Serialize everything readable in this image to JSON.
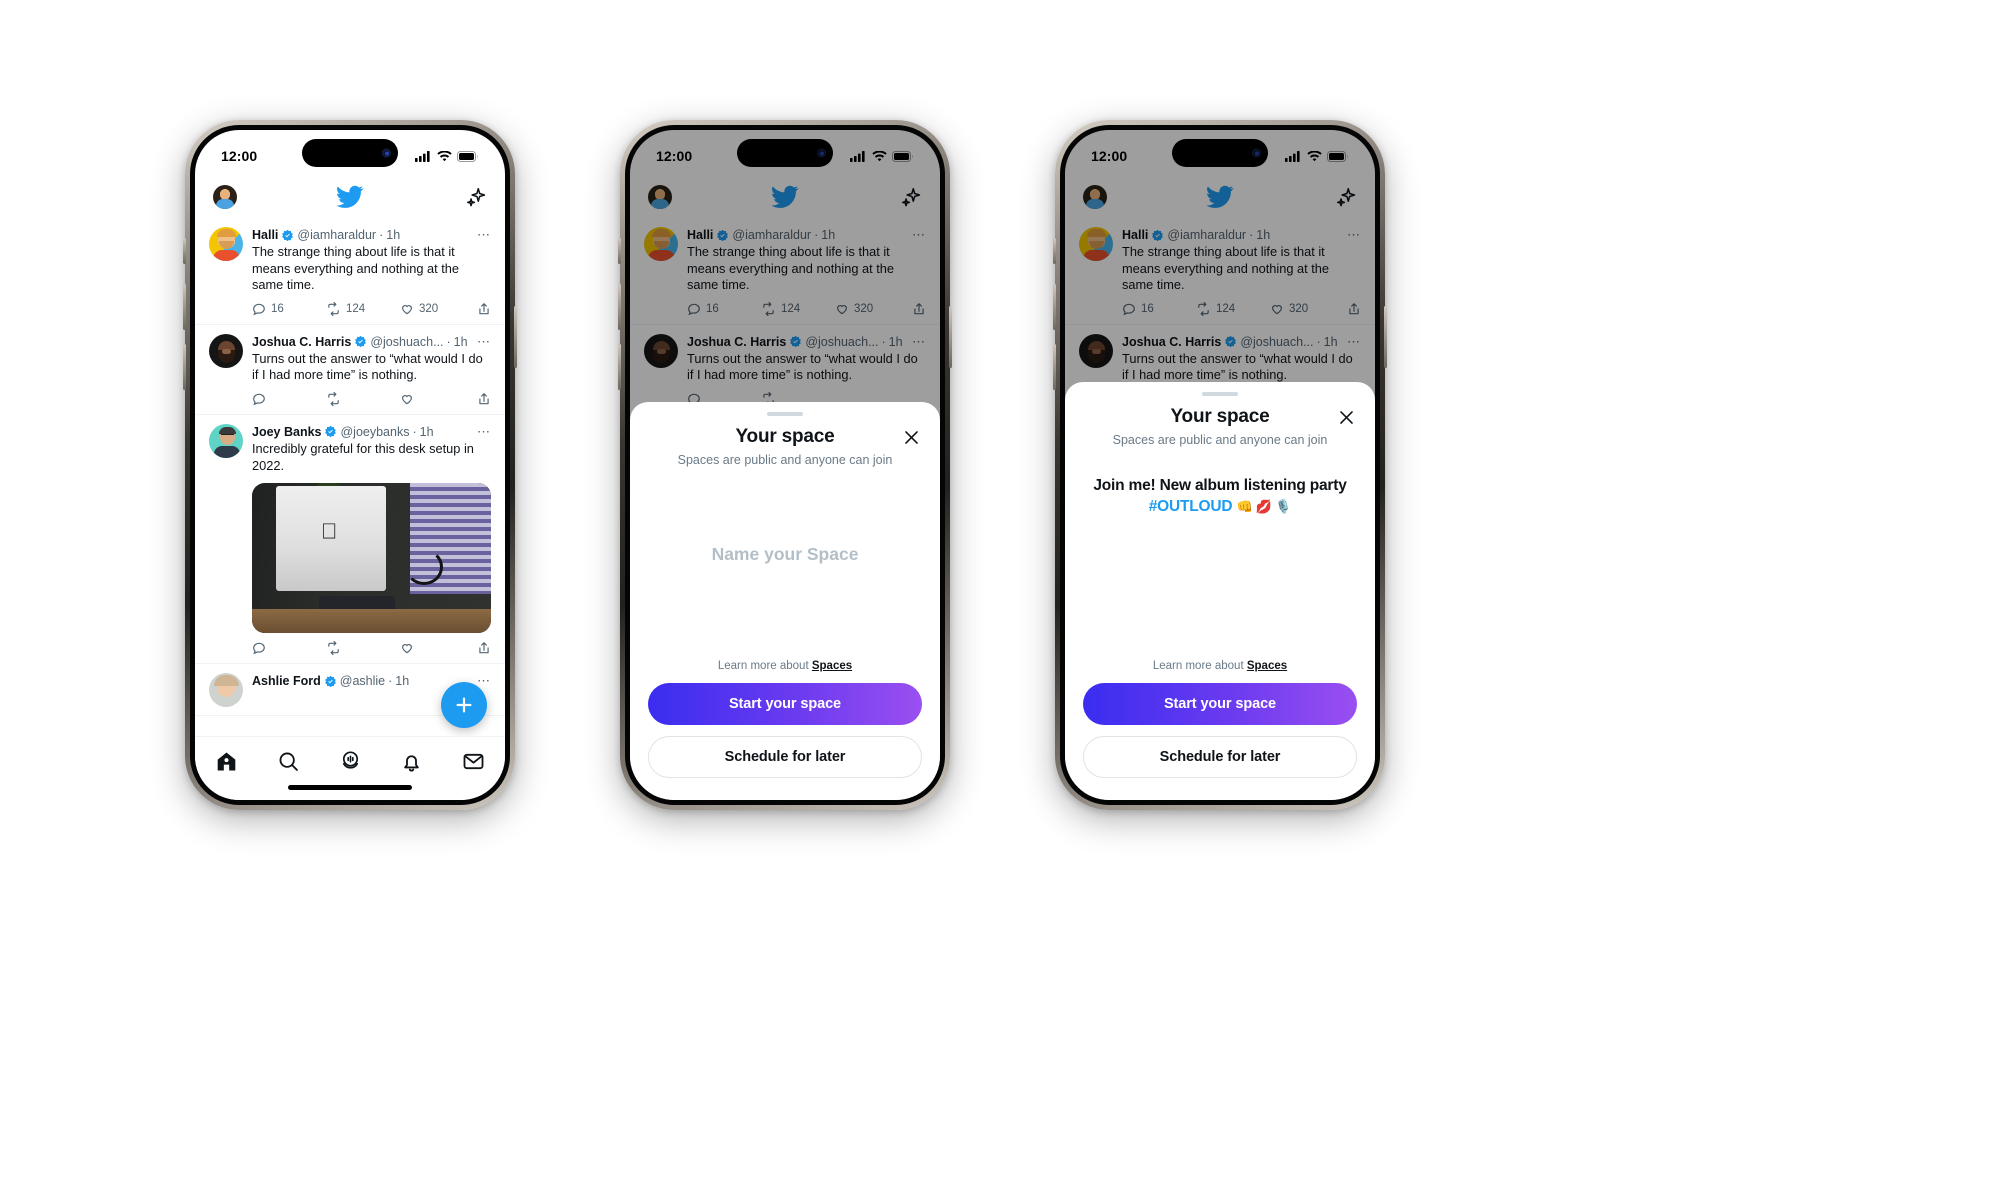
{
  "status_bar": {
    "time": "12:00",
    "icons": [
      "cellular-signal-icon",
      "wifi-icon",
      "battery-icon"
    ]
  },
  "app_header": {
    "avatar_name": "user-avatar",
    "logo": "twitter-bird-logo",
    "sparkle": "sparkle-icon"
  },
  "feed": {
    "tweets": [
      {
        "name": "Halli",
        "verified": true,
        "handle": "@iamharaldur",
        "time": "1h",
        "separator": "·",
        "text": "The strange thing about life is that it means everything and nothing at the same time.",
        "replies": "16",
        "retweets": "124",
        "likes": "320",
        "has_counts": true,
        "has_media": false
      },
      {
        "name": "Joshua C. Harris",
        "verified": true,
        "handle": "@joshuach...",
        "time": "1h",
        "separator": "·",
        "text": "Turns out the answer to “what would I do if I had more time” is nothing.",
        "replies": "",
        "retweets": "",
        "likes": "",
        "has_counts": false,
        "has_media": false
      },
      {
        "name": "Joey Banks",
        "verified": true,
        "handle": "@joeybanks",
        "time": "1h",
        "separator": "·",
        "text": "Incredibly grateful for this desk setup in 2022.",
        "replies": "",
        "retweets": "",
        "likes": "",
        "has_counts": false,
        "has_media": true,
        "media_alt": "desk-setup-photo"
      },
      {
        "name": "Ashlie Ford",
        "verified": true,
        "handle": "@ashlie",
        "time": "1h",
        "separator": "·",
        "text": "",
        "replies": "",
        "retweets": "",
        "likes": "",
        "has_counts": false,
        "has_media": false
      }
    ],
    "action_icons": [
      "reply-icon",
      "retweet-icon",
      "like-icon",
      "share-icon"
    ],
    "compose_fab": "compose-plus-icon"
  },
  "tabbar": {
    "items": [
      {
        "icon": "home-icon",
        "active": true
      },
      {
        "icon": "search-icon",
        "active": false
      },
      {
        "icon": "spaces-microphone-icon",
        "active": false
      },
      {
        "icon": "notifications-bell-icon",
        "active": false
      },
      {
        "icon": "messages-envelope-icon",
        "active": false
      }
    ]
  },
  "sheet_empty": {
    "title": "Your space",
    "subtitle": "Spaces are public and anyone can join",
    "close_icon": "close-icon",
    "name_placeholder": "Name your Space",
    "learn_prefix": "Learn more about",
    "learn_link": "Spaces",
    "primary_button": "Start your space",
    "secondary_button": "Schedule for later"
  },
  "sheet_filled": {
    "title": "Your space",
    "subtitle": "Spaces are public and anyone can join",
    "close_icon": "close-icon",
    "space_name_line1": "Join me! New album listening party",
    "space_name_hashtag": "#OUTLOUD",
    "space_name_emojis": "👊 💋 🎙️",
    "learn_prefix": "Learn more about",
    "learn_link": "Spaces",
    "primary_button": "Start your space",
    "secondary_button": "Schedule for later"
  },
  "colors": {
    "twitter_blue": "#1d9bf0",
    "gradient_start": "#3a2df0",
    "gradient_end": "#9a4ff0",
    "text_primary": "#0f1419",
    "text_secondary": "#536471"
  }
}
